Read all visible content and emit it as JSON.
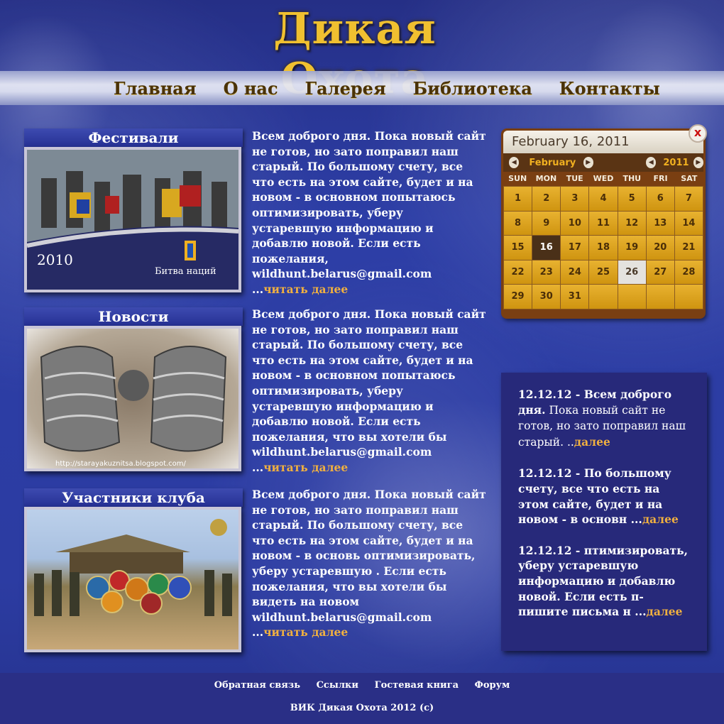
{
  "site": {
    "logo": "Дикая Охота"
  },
  "nav": [
    {
      "label": "Главная"
    },
    {
      "label": "О нас"
    },
    {
      "label": "Галерея"
    },
    {
      "label": "Библиотека"
    },
    {
      "label": "Контакты"
    }
  ],
  "sections": [
    {
      "title": "Фестивали",
      "image_caption_year": "2010",
      "image_caption_brand": "Битва наций",
      "lead": "Всем доброго дня.",
      "text": " Пока новый сайт не готов, но зато поправил наш старый. По большому счету, все что есть на этом сайте, будет и на новом - в основном попытаюсь оптимизировать, уберу устаревшую информацию и добавлю новой. Если есть пожелания, wildhunt.belarus@gmail.com ...",
      "more": "читать далее"
    },
    {
      "title": "Новости",
      "image_caption": "http://starayakuznitsa.blogspot.com/",
      "lead": "Всем доброго дня.",
      "text": " Пока новый сайт не готов, но зато поправил наш старый. По большому счету, все что есть на этом сайте, будет и на новом - в основном попытаюсь оптимизировать, уберу устаревшую информацию и добавлю новой. Если есть пожелания, что вы хотели бы wildhunt.belarus@gmail.com ...",
      "more": "читать далее"
    },
    {
      "title": "Участники клуба",
      "lead": "Всем доброго дня.",
      "text": " Пока новый сайт не готов, но зато поправил наш старый. По большому счету, все что есть на этом сайте, будет и на новом - в основь оптимизировать, уберу устаревшую . Если есть пожелания, что вы хотели бы видеть на новом wildhunt.belarus@gmail.com ...",
      "more": "читать далее"
    }
  ],
  "calendar": {
    "header": "February 16, 2011",
    "month": "February",
    "year": "2011",
    "close": "x",
    "weekdays": [
      "SUN",
      "MON",
      "TUE",
      "WED",
      "THU",
      "FRI",
      "SAT"
    ],
    "days": [
      "1",
      "2",
      "3",
      "4",
      "5",
      "6",
      "7",
      "8",
      "9",
      "10",
      "11",
      "12",
      "13",
      "14",
      "15",
      "16",
      "17",
      "18",
      "19",
      "20",
      "21",
      "22",
      "23",
      "24",
      "25",
      "26",
      "27",
      "28",
      "29",
      "30",
      "31"
    ],
    "today": "16",
    "selected": "26"
  },
  "news": [
    {
      "date": "12.12.12",
      "sep": " - ",
      "lead": "Всем доброго дня.",
      "text": " Пока новый сайт не готов, но зато поправил наш старый. ..",
      "more": "далее"
    },
    {
      "date": "12.12.12",
      "sep": " - ",
      "lead": "",
      "text": "По большому счету, все что есть на этом сайте, будет и на новом - в основн ...",
      "more": "далее"
    },
    {
      "date": "12.12.12",
      "sep": " - ",
      "lead": "",
      "text": "птимизировать, уберу устаревшую информацию и добавлю новой. Если есть п- пишите письма н ...",
      "more": "далее"
    }
  ],
  "footer": {
    "links": [
      {
        "label": "Обратная связь"
      },
      {
        "label": "Ссылки"
      },
      {
        "label": "Гостевая книга"
      },
      {
        "label": "Форум"
      }
    ],
    "copyright": "ВИК Дикая Охота 2012 (c)"
  },
  "colors": {
    "background": "#2c3ca2",
    "nav_text": "#4a3208",
    "link_more": "#f0b040",
    "calendar_frame": "#7a3f12",
    "calendar_day": "#dca11e",
    "news_panel": "#27297a"
  }
}
